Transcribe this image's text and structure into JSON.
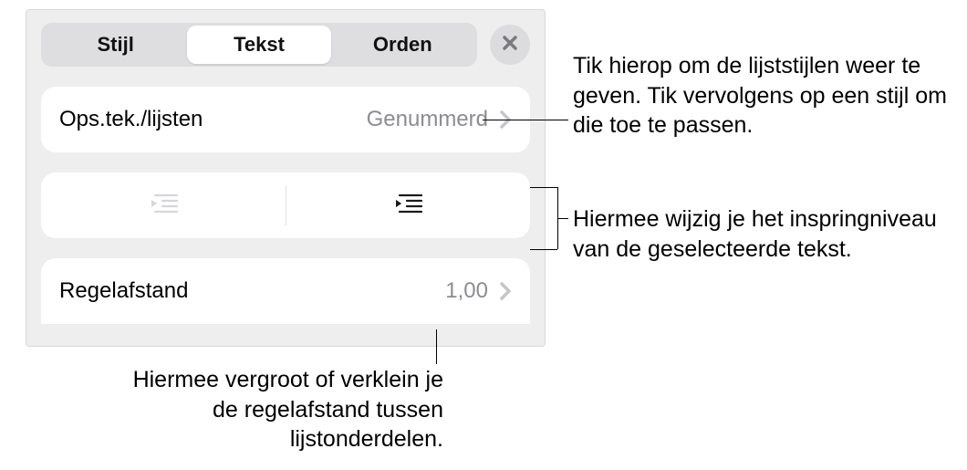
{
  "tabs": {
    "style": "Stijl",
    "text": "Tekst",
    "order": "Orden"
  },
  "bullets_lists": {
    "label": "Ops.tek./lijsten",
    "value": "Genummerd"
  },
  "line_spacing": {
    "label": "Regelafstand",
    "value": "1,00"
  },
  "callouts": {
    "list_styles": "Tik hierop om de lijststijlen weer te geven. Tik vervolgens op een stijl om die toe te passen.",
    "indent": "Hiermee wijzig je het inspringniveau van de geselecteerde tekst.",
    "spacing": "Hiermee vergroot of verklein je de regelafstand tussen lijstonderdelen."
  }
}
